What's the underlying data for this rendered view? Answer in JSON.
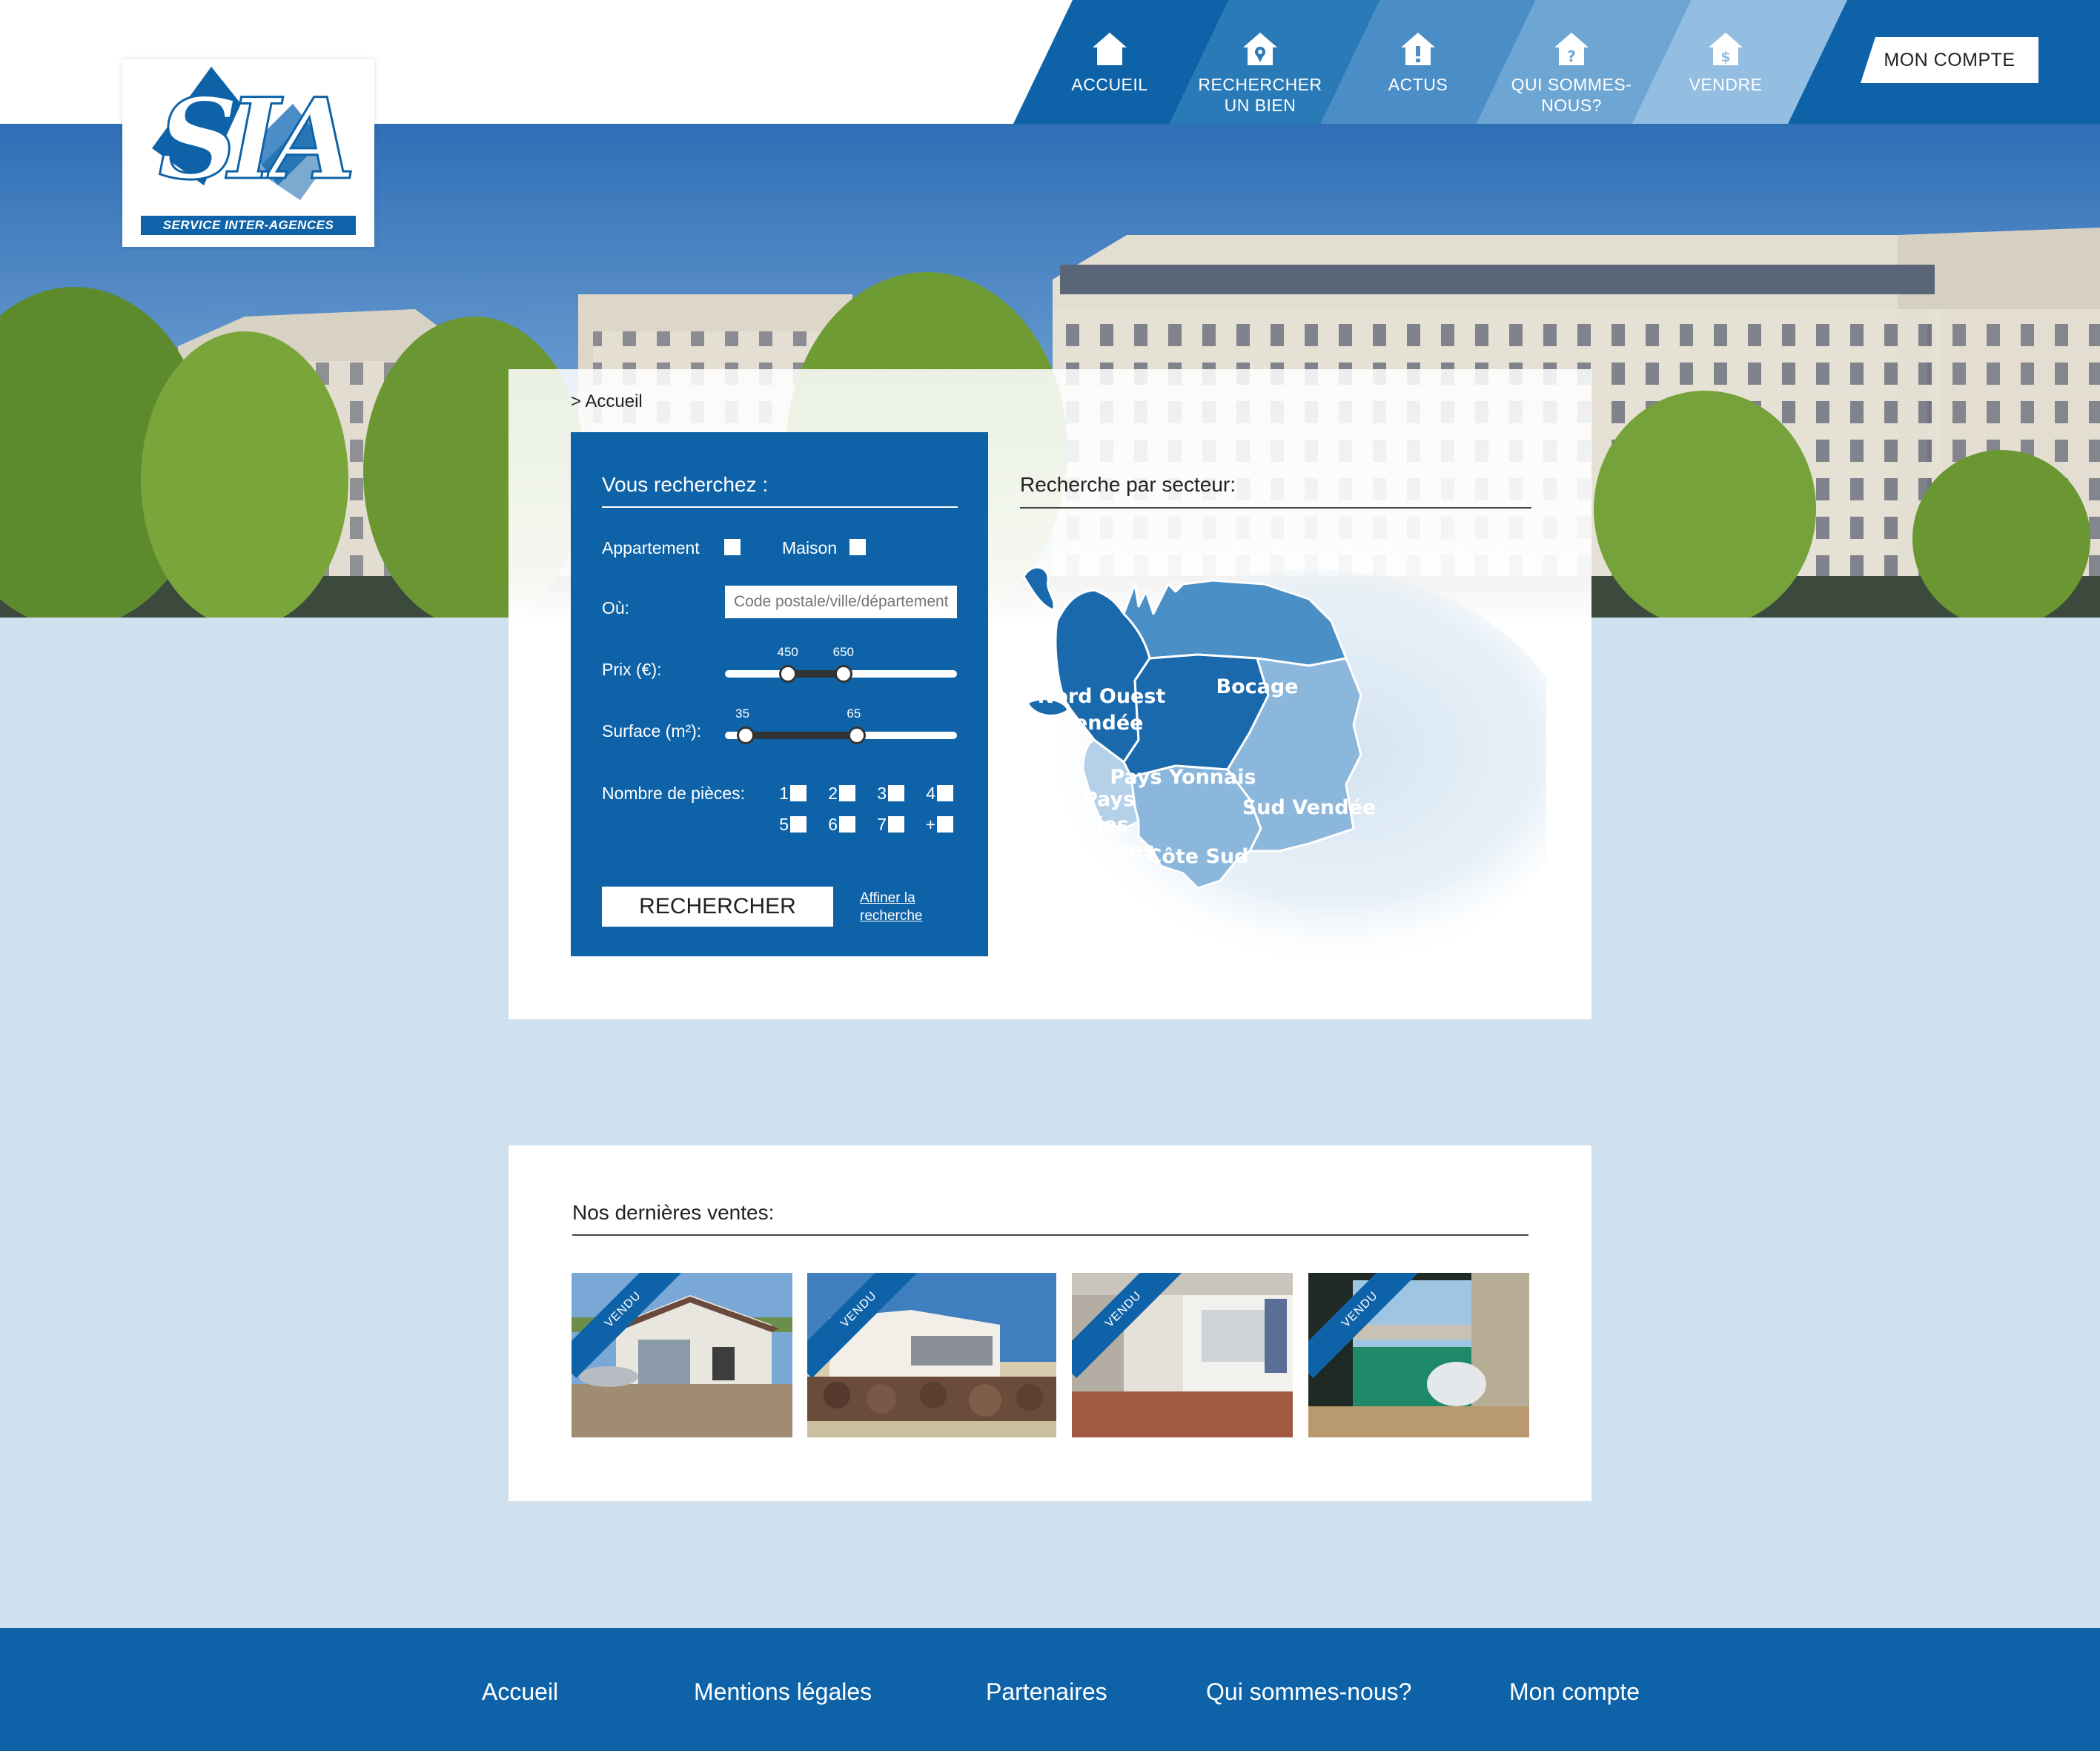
{
  "brand": {
    "logo_letters": "SIA",
    "tagline": "SERVICE INTER-AGENCES",
    "colors": {
      "primary": "#0e63a8",
      "background": "#cfe0ee",
      "region_dark": "#1a69ad",
      "region_mid": "#4a8fc5",
      "region_light": "#8bb7dc",
      "region_pale": "#b5d1ea"
    }
  },
  "nav": {
    "items": [
      {
        "label": "ACCUEIL",
        "icon": "home-icon",
        "color": "#0e63a8"
      },
      {
        "label": "RECHERCHER\nUN BIEN",
        "icon": "location-house-icon",
        "color": "#2a7ab8"
      },
      {
        "label": "ACTUS",
        "icon": "news-house-icon",
        "color": "#4b8ec7"
      },
      {
        "label": "QUI SOMMES-\nNOUS?",
        "icon": "question-house-icon",
        "color": "#6ea6d3"
      },
      {
        "label": "VENDRE",
        "icon": "sell-house-icon",
        "color": "#93bde1"
      }
    ],
    "account_label": "MON COMPTE"
  },
  "breadcrumb": "> Accueil",
  "search": {
    "title": "Vous recherchez :",
    "type_apartment": "Appartement",
    "type_house": "Maison",
    "where_label": "Où:",
    "where_placeholder": "Code postale/ville/département",
    "price_label": "Prix (€):",
    "price_min": "450",
    "price_max": "650",
    "price_min_pct": 0.27,
    "price_max_pct": 0.51,
    "surface_label": "Surface (m²):",
    "surface_min": "35",
    "surface_max": "65",
    "surface_min_pct": 0.09,
    "surface_max_pct": 0.57,
    "rooms_label": "Nombre de pièces:",
    "rooms": [
      "1",
      "2",
      "3",
      "4",
      "5",
      "6",
      "7",
      "+"
    ],
    "submit_label": "RECHERCHER",
    "refine_label": "Affiner la recherche"
  },
  "sectors": {
    "title": "Recherche par secteur:",
    "regions": {
      "nord_ouest": "Nord Ouest Vendée",
      "nord_ouest_l1": "Nord Ouest",
      "nord_ouest_l2": "Vendée",
      "bocage": "Bocage",
      "pays_yonnais": "Pays Yonnais",
      "pays_olonnes_l1": "Pays",
      "pays_olonnes_l2": "des",
      "pays_olonnes_l3": "Olonnes",
      "sud_vendee": "Sud Vendée",
      "cote_sud": "Côte Sud"
    }
  },
  "sales": {
    "title": "Nos dernières ventes:",
    "badge": "VENDU",
    "items": [
      "house-with-veranda-photo",
      "beach-villa-photo",
      "house-with-terrace-photo",
      "balcony-sea-view-photo"
    ]
  },
  "footer": {
    "links": [
      "Accueil",
      "Mentions légales",
      "Partenaires",
      "Qui sommes-nous?",
      "Mon compte"
    ]
  }
}
